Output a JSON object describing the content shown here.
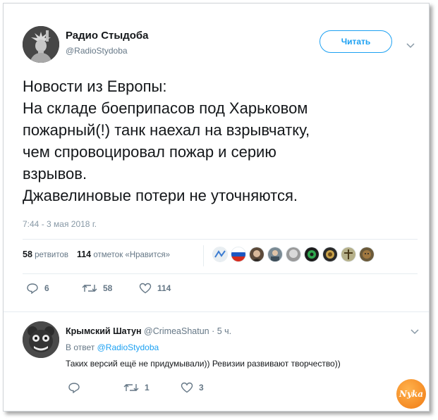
{
  "author": {
    "name": "Радио Стыдоба",
    "handle": "@RadioStydoba",
    "avatar_icon": "statue-of-liberty-avatar"
  },
  "follow_label": "Читать",
  "tweet": {
    "lines": [
      "Новости из Европы:",
      "На складе боеприпасов под Харьковом",
      "пожарный(!) танк наехал на взрывчатку,",
      "чем спровоцировал пожар и серию",
      "взрывов.",
      "Джавелиновые потери не уточняются."
    ],
    "timestamp": "7:44 - 3 мая 2018 г."
  },
  "stats": {
    "retweets_count": "58",
    "retweets_label": "ретвитов",
    "likes_count": "114",
    "likes_label": "отметок «Нравится»"
  },
  "actions": {
    "replies": "6",
    "retweets": "58",
    "likes": "114"
  },
  "reply": {
    "name": "Крымский Шатун",
    "handle": "@CrimeaShatun",
    "time": "· 5 ч.",
    "in_reply_prefix": "В ответ",
    "in_reply_handle": "@RadioStydoba",
    "text": "Таких версий ещё не придумывали)) Ревизии развивают творчество))",
    "actions": {
      "replies": "",
      "retweets": "1",
      "likes": "3"
    }
  },
  "watermark": "Nyka",
  "colors": {
    "accent": "#1da1f2",
    "muted": "#657786",
    "text": "#14171a"
  }
}
